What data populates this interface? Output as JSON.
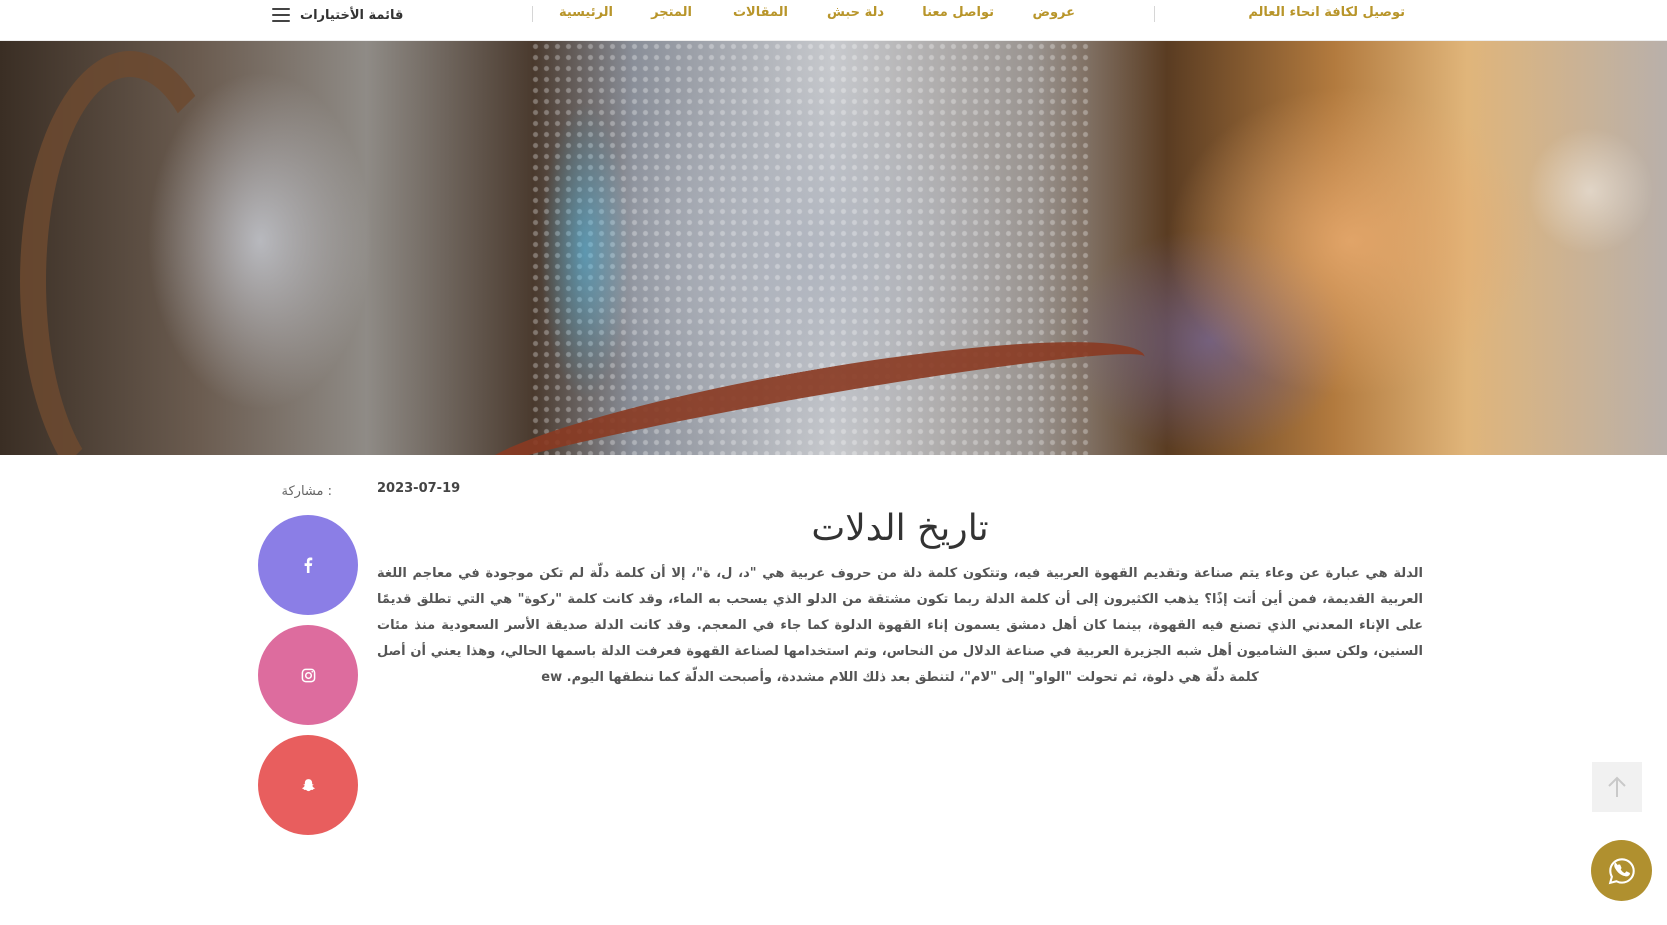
{
  "header": {
    "menu_label": "قائمة الأختيارات",
    "nav": [
      {
        "label": "الرئيسية"
      },
      {
        "label": "المتجر"
      },
      {
        "label": "المقالات"
      },
      {
        "label": "دلة حبش"
      },
      {
        "label": "تواصل معنا"
      },
      {
        "label": "عروض"
      }
    ],
    "shipping": "توصيل لكافة انحاء العالم"
  },
  "share": {
    "label": ": مشاركة",
    "items": [
      {
        "name": "facebook",
        "icon": "facebook-icon",
        "color": "#8b7ee6"
      },
      {
        "name": "instagram",
        "icon": "instagram-icon",
        "color": "#dd6c9e"
      },
      {
        "name": "snapchat",
        "icon": "snapchat-icon",
        "color": "#e85e5e"
      }
    ]
  },
  "article": {
    "date": "2023-07-19",
    "title": "تاريخ الدلات",
    "body": "الدلة هي عبارة عن وعاء يتم صناعة وتقديم القهوة العربية فيه، وتتكون كلمة دلة من حروف عربية هي \"د، ل، ة\"، إلا أن كلمة دلّة لم تكن موجودة في معاجم اللغة العربية القديمة، فمن أين أتت إذًا؟ يذهب الكثيرون إلى أن كلمة الدلة ربما تكون مشتقة من الدلو الذي يسحب به الماء، وقد كانت كلمة \"ركوة\" هي التي تطلق قديمًا على الإناء المعدني الذي تصنع فيه القهوة، بينما كان أهل دمشق يسمون إناء القهوة الدلوة كما جاء في المعجم. وقد كانت الدلة صديقة الأسر السعودية منذ مئات السنين، ولكن سبق الشاميون أهل شبه الجزيرة العربية في صناعة الدلال من النحاس، وتم استخدامها لصناعة القهوة فعرفت الدلة باسمها الحالي، وهذا يعني أن أصل كلمة دلّة هي دلوة، ثم تحولت \"الواو\" إلى \"لام\"، لتنطق بعد ذلك اللام مشددة، وأصبحت الدلّة كما ننطقها اليوم. ew"
  },
  "floating": {
    "back_to_top_icon": "arrow-up-icon",
    "whatsapp_icon": "whatsapp-icon",
    "whatsapp_color": "#b0902f"
  },
  "colors": {
    "accent": "#b8952a"
  }
}
